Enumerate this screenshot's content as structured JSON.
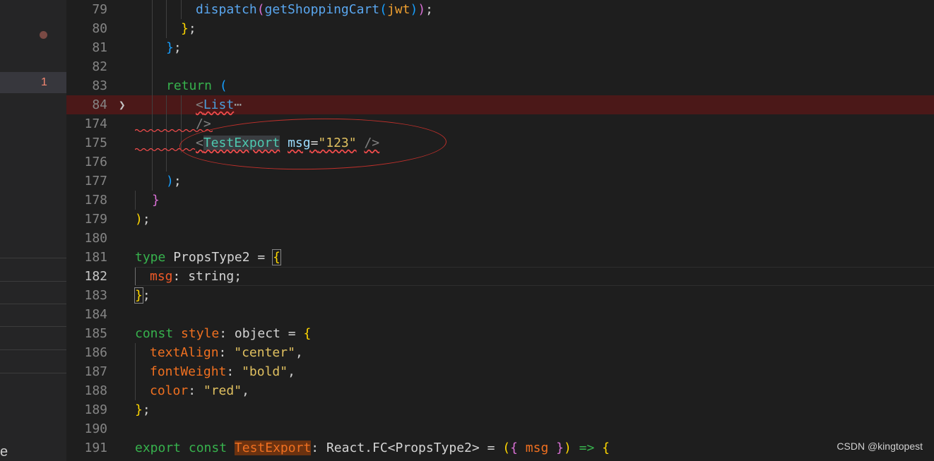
{
  "sidebar": {
    "problem_badge": "1",
    "trailing_char": "e"
  },
  "watermark": "CSDN @kingtopest",
  "lines": [
    {
      "n": "79"
    },
    {
      "n": "80"
    },
    {
      "n": "81"
    },
    {
      "n": "82"
    },
    {
      "n": "83"
    },
    {
      "n": "84"
    },
    {
      "n": "174"
    },
    {
      "n": "175"
    },
    {
      "n": "176"
    },
    {
      "n": "177"
    },
    {
      "n": "178"
    },
    {
      "n": "179"
    },
    {
      "n": "180"
    },
    {
      "n": "181"
    },
    {
      "n": "182"
    },
    {
      "n": "183"
    },
    {
      "n": "184"
    },
    {
      "n": "185"
    },
    {
      "n": "186"
    },
    {
      "n": "187"
    },
    {
      "n": "188"
    },
    {
      "n": "189"
    },
    {
      "n": "190"
    },
    {
      "n": "191"
    }
  ],
  "code": {
    "l79": {
      "fn1": "dispatch",
      "fn2": "getShoppingCart",
      "arg": "jwt",
      "end": "));"
    },
    "l80": {
      "t": "};"
    },
    "l81": {
      "t": "};"
    },
    "l83": {
      "kw": "return",
      "p": "("
    },
    "l84": {
      "lt": "<",
      "tag": "List",
      "ell": "⋯"
    },
    "l174": {
      "t": "/>"
    },
    "l175": {
      "lt": "<",
      "tag": "TestExport",
      "attr": "msg",
      "eq": "=",
      "val": "\"123\"",
      "close": "/>"
    },
    "l177": {
      "t": ");"
    },
    "l178": {
      "t": "}"
    },
    "l179": {
      "t": ");"
    },
    "l181": {
      "kw": "type",
      "name": "PropsType2",
      "eq": " = ",
      "p": "{"
    },
    "l182": {
      "prop": "msg",
      "colon": ": ",
      "ty": "string",
      "semi": ";"
    },
    "l183": {
      "p": "}",
      "semi": ";"
    },
    "l185": {
      "kw": "const",
      "name": "style",
      "colon": ": ",
      "ty": "object",
      "eq": " = ",
      "p": "{"
    },
    "l186": {
      "prop": "textAlign",
      "colon": ": ",
      "val": "\"center\"",
      "comma": ","
    },
    "l187": {
      "prop": "fontWeight",
      "colon": ": ",
      "val": "\"bold\"",
      "comma": ","
    },
    "l188": {
      "prop": "color",
      "colon": ": ",
      "val": "\"red\"",
      "comma": ","
    },
    "l189": {
      "p": "}",
      "semi": ";"
    },
    "l191": {
      "kw1": "export",
      "kw2": "const",
      "name": "TestExport",
      "colon": ": ",
      "ty": "React.FC",
      "lt": "<",
      "gen": "PropsType2",
      "gt": ">",
      "eq": " = ",
      "p1": "(",
      "p2": "{",
      "arg": " msg ",
      "p3": "}",
      "p4": ")",
      "arrow": " => ",
      "p5": "{"
    }
  }
}
